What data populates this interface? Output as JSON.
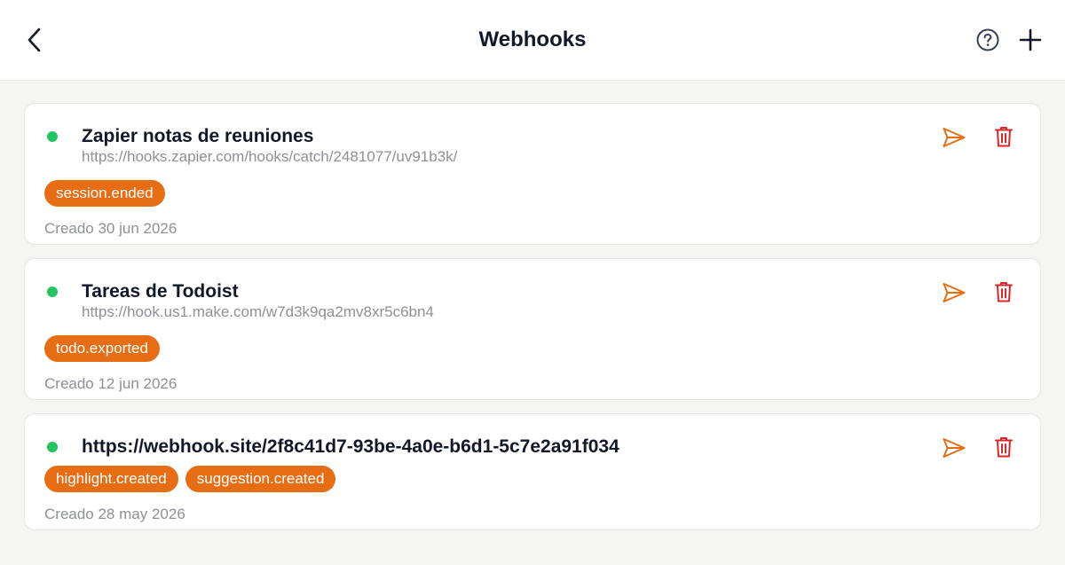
{
  "header": {
    "title": "Webhooks",
    "back_icon": "chevron-left-icon",
    "help_icon": "help-circle-icon",
    "add_icon": "plus-icon"
  },
  "colors": {
    "accent": "#e76d14",
    "active_dot": "#22c55e",
    "delete": "#dc2626",
    "muted_text": "#8e9098"
  },
  "webhooks": [
    {
      "title": "Zapier notas de reuniones",
      "url": "https://hooks.zapier.com/hooks/catch/2481077/uv91b3k/",
      "events": [
        "session.ended"
      ],
      "created": "Creado 30 jun 2026",
      "status": "active"
    },
    {
      "title": "Tareas de Todoist",
      "url": "https://hook.us1.make.com/w7d3k9qa2mv8xr5c6bn4",
      "events": [
        "todo.exported"
      ],
      "created": "Creado 12 jun 2026",
      "status": "active"
    },
    {
      "title": "https://webhook.site/2f8c41d7-93be-4a0e-b6d1-5c7e2a91f034",
      "events": [
        "highlight.created",
        "suggestion.created"
      ],
      "created": "Creado 28 may 2026",
      "status": "active"
    }
  ]
}
